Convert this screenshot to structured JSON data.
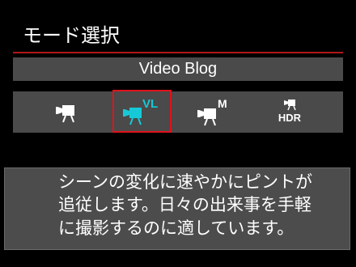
{
  "screen": {
    "title": "モード選択"
  },
  "selected_mode": {
    "name": "Video Blog"
  },
  "modes": [
    {
      "id": "movie-auto",
      "icon": "movie-camera-icon",
      "badge": "",
      "selected": false
    },
    {
      "id": "movie-vlog",
      "icon": "movie-camera-vl-icon",
      "badge": "VL",
      "selected": true
    },
    {
      "id": "movie-manual",
      "icon": "movie-camera-m-icon",
      "badge": "M",
      "selected": false
    },
    {
      "id": "movie-hdr",
      "icon": "movie-camera-hdr-icon",
      "badge": "HDR",
      "selected": false
    }
  ],
  "description": {
    "lines": [
      "シーンの変化に速やかにピントが",
      "追従します。日々の出来事を手軽",
      "に撮影するのに適しています。"
    ]
  },
  "colors": {
    "background": "#000000",
    "panel": "#4a4a4a",
    "accent_red": "#e0121b",
    "selected_icon": "#17c9d6",
    "text": "#ffffff"
  }
}
